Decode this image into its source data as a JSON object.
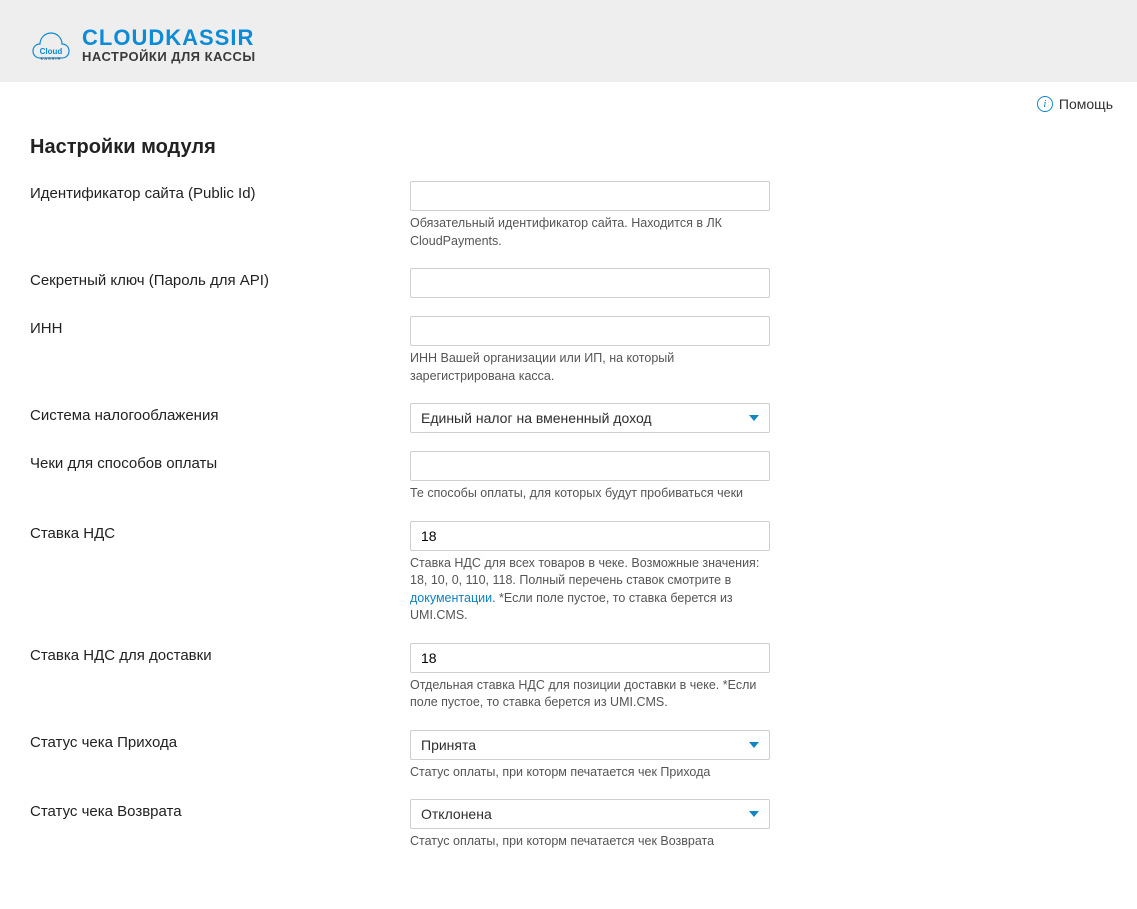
{
  "header": {
    "brand": "CLOUDKASSIR",
    "subtitle": "НАСТРОЙКИ ДЛЯ КАССЫ"
  },
  "help": {
    "label": "Помощь"
  },
  "section": {
    "title": "Настройки модуля"
  },
  "fields": {
    "public_id": {
      "label": "Идентификатор сайта (Public Id)",
      "value": "",
      "hint": "Обязательный идентификатор сайта. Находится в ЛК CloudPayments."
    },
    "secret": {
      "label": "Секретный ключ (Пароль для API)",
      "value": ""
    },
    "inn": {
      "label": "ИНН",
      "value": "",
      "hint": "ИНН Вашей организации или ИП, на который зарегистрирована касса."
    },
    "tax_system": {
      "label": "Система налогооблажения",
      "value": "Единый налог на вмененный доход"
    },
    "payment_methods": {
      "label": "Чеки для способов оплаты",
      "value": "",
      "hint": "Те способы оплаты, для которых будут пробиваться чеки"
    },
    "vat": {
      "label": "Ставка НДС",
      "value": "18",
      "hint_before": "Ставка НДС для всех товаров в чеке. Возможные значения: 18, 10, 0, 110, 118. Полный перечень ставок смотрите в ",
      "hint_link": "документации",
      "hint_after": ". *Если поле пустое, то ставка берется из UMI.CMS."
    },
    "vat_delivery": {
      "label": "Ставка НДС для доставки",
      "value": "18",
      "hint": "Отдельная ставка НДС для позиции доставки в чеке. *Если поле пустое, то ставка берется из UMI.CMS."
    },
    "status_income": {
      "label": "Статус чека Прихода",
      "value": "Принята",
      "hint": "Статус оплаты, при которм печатается чек Прихода"
    },
    "status_refund": {
      "label": "Статус чека Возврата",
      "value": "Отклонена",
      "hint": "Статус оплаты, при которм печатается чек Возврата"
    }
  }
}
